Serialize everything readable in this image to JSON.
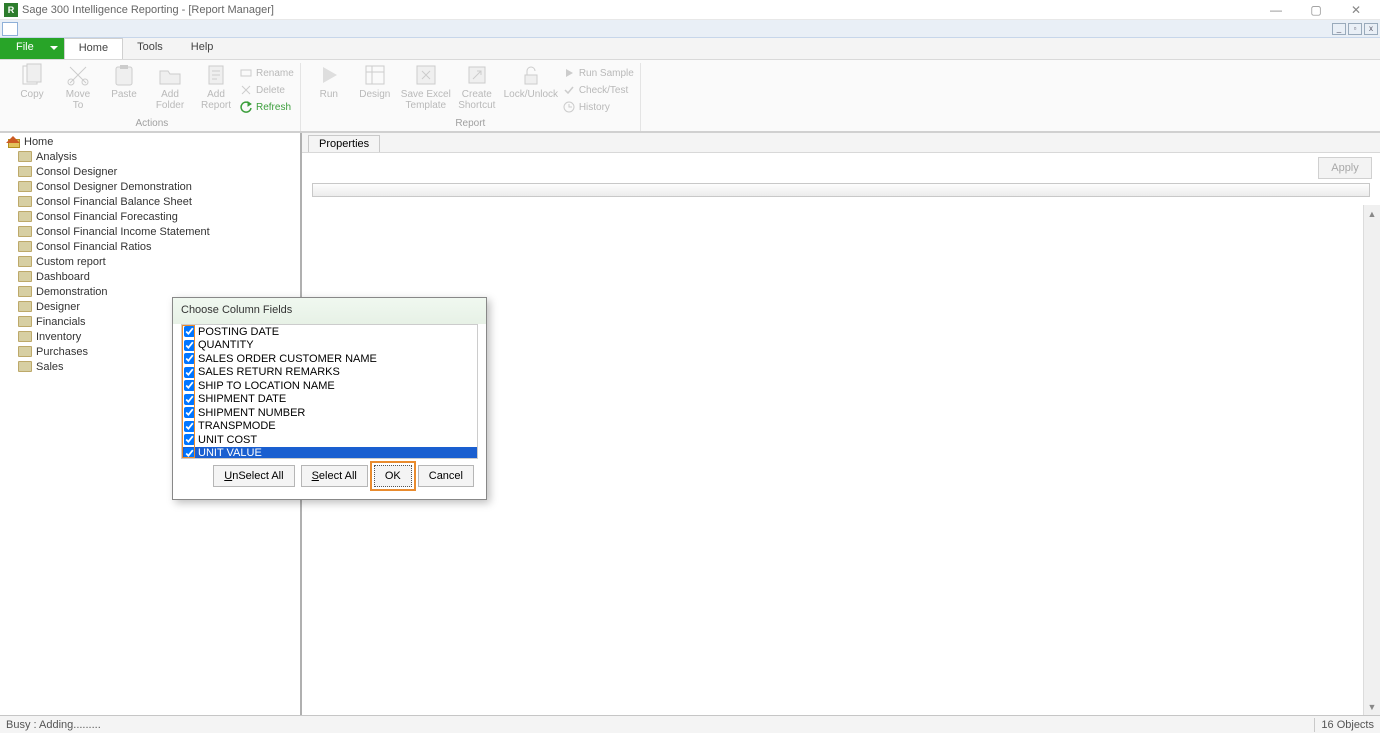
{
  "titlebar": {
    "text": "Sage 300 Intelligence Reporting  - [Report Manager]"
  },
  "window_controls": {
    "min": "—",
    "max": "▢",
    "close": "✕"
  },
  "menu": {
    "file": "File",
    "tabs": [
      {
        "label": "Home",
        "active": true
      },
      {
        "label": "Tools",
        "active": false
      },
      {
        "label": "Help",
        "active": false
      }
    ]
  },
  "ribbon": {
    "group_actions": "Actions",
    "group_report": "Report",
    "copy": "Copy",
    "move_to": "Move\nTo",
    "paste": "Paste",
    "add_folder": "Add\nFolder",
    "add_report": "Add\nReport",
    "rename": "Rename",
    "delete": "Delete",
    "refresh": "Refresh",
    "run": "Run",
    "design": "Design",
    "save_excel": "Save Excel\nTemplate",
    "create_shortcut": "Create\nShortcut",
    "lock_unlock": "Lock/Unlock",
    "run_sample": "Run Sample",
    "check_test": "Check/Test",
    "history": "History"
  },
  "tree": {
    "root": "Home",
    "items": [
      "Analysis",
      "Consol Designer",
      "Consol Designer Demonstration",
      "Consol Financial Balance Sheet",
      "Consol Financial Forecasting",
      "Consol Financial Income Statement",
      "Consol Financial Ratios",
      "Custom report",
      "Dashboard",
      "Demonstration",
      "Designer",
      "Financials",
      "Inventory",
      "Purchases",
      "Sales"
    ]
  },
  "properties_tab": "Properties",
  "apply": "Apply",
  "dialog": {
    "title": "Choose Column Fields",
    "fields": [
      {
        "label": "POSTING DATE",
        "checked": true,
        "selected": false
      },
      {
        "label": "QUANTITY",
        "checked": true,
        "selected": false
      },
      {
        "label": "SALES ORDER CUSTOMER NAME",
        "checked": true,
        "selected": false
      },
      {
        "label": "SALES RETURN REMARKS",
        "checked": true,
        "selected": false
      },
      {
        "label": "SHIP TO LOCATION NAME",
        "checked": true,
        "selected": false
      },
      {
        "label": "SHIPMENT DATE",
        "checked": true,
        "selected": false
      },
      {
        "label": "SHIPMENT NUMBER",
        "checked": true,
        "selected": false
      },
      {
        "label": "TRANSPMODE",
        "checked": true,
        "selected": false
      },
      {
        "label": "UNIT COST",
        "checked": true,
        "selected": false
      },
      {
        "label": "UNIT VALUE",
        "checked": true,
        "selected": true
      }
    ],
    "unselect_all_pre": "U",
    "unselect_all_rest": "nSelect All",
    "select_all_pre": "S",
    "select_all_rest": "elect All",
    "ok": "OK",
    "cancel": "Cancel"
  },
  "status": {
    "left": "Busy : Adding.........",
    "right": "16 Objects"
  }
}
